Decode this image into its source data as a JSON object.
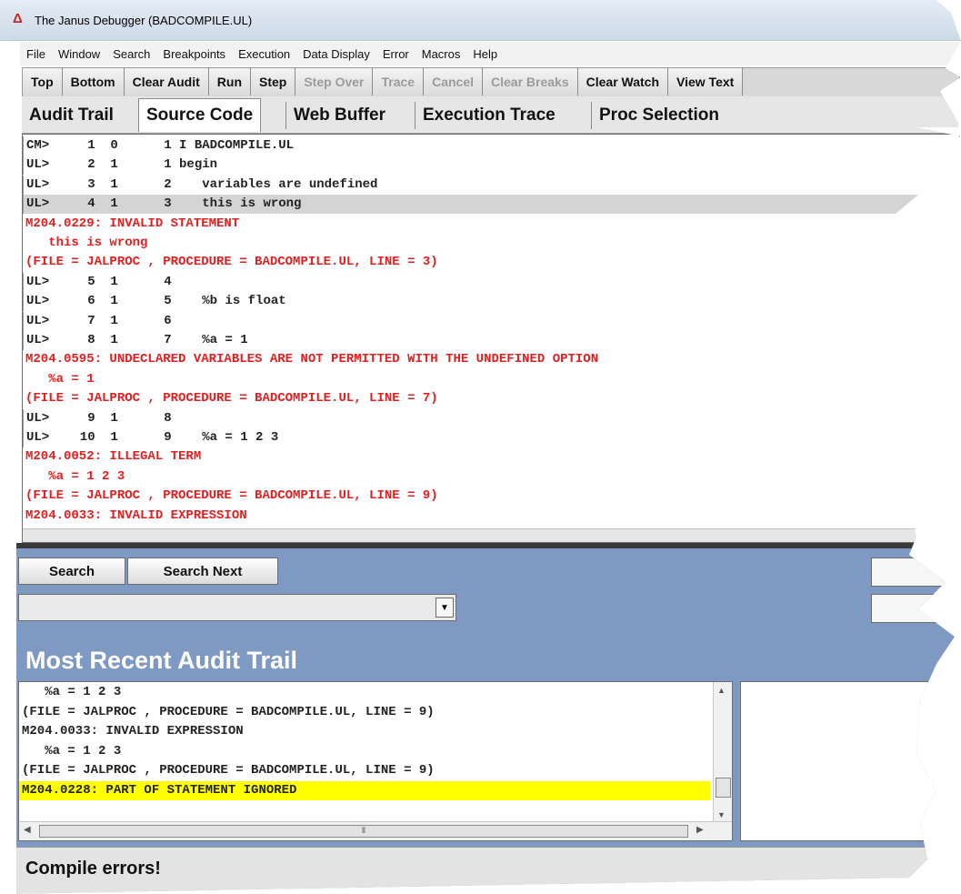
{
  "window": {
    "title": "The Janus Debugger (BADCOMPILE.UL)",
    "app_icon": "janus-debugger-icon"
  },
  "menu": [
    "File",
    "Window",
    "Search",
    "Breakpoints",
    "Execution",
    "Data Display",
    "Error",
    "Macros",
    "Help"
  ],
  "toolbar": {
    "top": "Top",
    "bottom": "Bottom",
    "clear_audit": "Clear Audit",
    "run": "Run",
    "step": "Step",
    "step_over": "Step Over",
    "trace": "Trace",
    "cancel": "Cancel",
    "clear_breaks": "Clear Breaks",
    "clear_watch": "Clear Watch",
    "view_text": "View Text"
  },
  "tabs": {
    "audit_trail": "Audit Trail",
    "source_code": "Source Code",
    "web_buffer": "Web Buffer",
    "execution_trace": "Execution Trace",
    "proc_selection": "Proc Selection",
    "active": "Source Code"
  },
  "source_lines": [
    {
      "kind": "code",
      "text": "CM>     1  0      1 I BADCOMPILE.UL"
    },
    {
      "kind": "code",
      "text": "UL>     2  1      1 begin"
    },
    {
      "kind": "code",
      "text": "UL>     3  1      2    variables are undefined"
    },
    {
      "kind": "code",
      "text": "UL>     4  1      3    this is wrong"
    },
    {
      "kind": "err",
      "text": "M204.0229: INVALID STATEMENT"
    },
    {
      "kind": "err",
      "text": "   this is wrong"
    },
    {
      "kind": "err",
      "text": "(FILE = JALPROC , PROCEDURE = BADCOMPILE.UL, LINE = 3)"
    },
    {
      "kind": "code",
      "text": "UL>     5  1      4"
    },
    {
      "kind": "code",
      "text": "UL>     6  1      5    %b is float"
    },
    {
      "kind": "code",
      "text": "UL>     7  1      6"
    },
    {
      "kind": "code",
      "text": "UL>     8  1      7    %a = 1"
    },
    {
      "kind": "err",
      "text": "M204.0595: UNDECLARED VARIABLES ARE NOT PERMITTED WITH THE UNDEFINED OPTION"
    },
    {
      "kind": "err",
      "text": "   %a = 1"
    },
    {
      "kind": "err",
      "text": "(FILE = JALPROC , PROCEDURE = BADCOMPILE.UL, LINE = 7)"
    },
    {
      "kind": "code",
      "text": "UL>     9  1      8"
    },
    {
      "kind": "code",
      "text": "UL>    10  1      9    %a = 1 2 3"
    },
    {
      "kind": "err",
      "text": "M204.0052: ILLEGAL TERM"
    },
    {
      "kind": "err",
      "text": "   %a = 1 2 3"
    },
    {
      "kind": "err",
      "text": "(FILE = JALPROC , PROCEDURE = BADCOMPILE.UL, LINE = 9)"
    },
    {
      "kind": "err",
      "text": "M204.0033: INVALID EXPRESSION"
    }
  ],
  "highlighted_source_line": 3,
  "search": {
    "search_label": "Search",
    "search_next_label": "Search Next",
    "combo_value": ""
  },
  "audit": {
    "heading": "Most Recent Audit Trail",
    "lines": [
      "   %a = 1 2 3",
      "(FILE = JALPROC , PROCEDURE = BADCOMPILE.UL, LINE = 9)",
      "M204.0033: INVALID EXPRESSION",
      "   %a = 1 2 3",
      "(FILE = JALPROC , PROCEDURE = BADCOMPILE.UL, LINE = 9)",
      "M204.0228: PART OF STATEMENT IGNORED"
    ],
    "highlighted_line": 5,
    "highlight_color": "#ffff00"
  },
  "status": {
    "text": "Compile errors!"
  },
  "colors": {
    "error_text": "#e02020",
    "panel_blue": "#7f9ac2",
    "selection_gray": "#d4d4d4"
  }
}
